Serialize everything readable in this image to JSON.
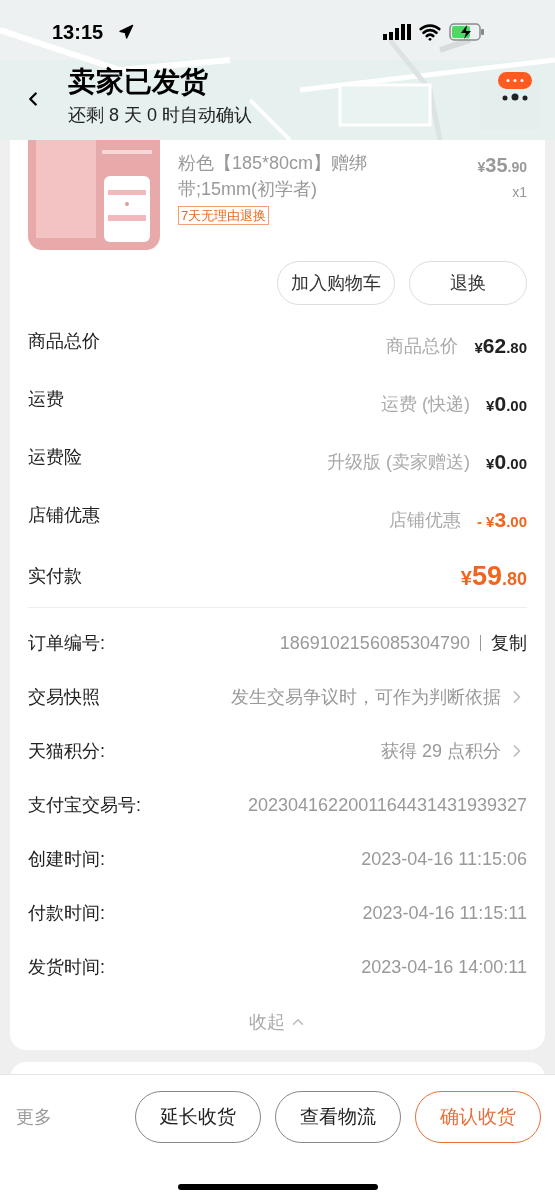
{
  "status_bar": {
    "time": "13:15"
  },
  "header": {
    "title": "卖家已发货",
    "subtitle": "还剩 8 天 0 时自动确认"
  },
  "product": {
    "spec": "粉色【185*80cm】赠绑带;15mm(初学者)",
    "tag": "7天无理由退换",
    "price": {
      "symbol": "¥",
      "integer": "35",
      "decimal": ".90"
    },
    "quantity": "x1",
    "buttons": [
      "加入购物车",
      "退换"
    ]
  },
  "fees": [
    {
      "label": "商品总价",
      "note": "商品总价",
      "amount": {
        "symbol": "¥",
        "integer": "62",
        "decimal": ".80"
      },
      "kind": "normal"
    },
    {
      "label": "运费",
      "note": "运费 (快递)",
      "amount": {
        "symbol": "¥",
        "integer": "0",
        "decimal": ".00"
      },
      "kind": "normal"
    },
    {
      "label": "运费险",
      "note": "升级版 (卖家赠送)",
      "amount": {
        "symbol": "¥",
        "integer": "0",
        "decimal": ".00"
      },
      "kind": "normal"
    },
    {
      "label": "店铺优惠",
      "note": "店铺优惠",
      "amount": {
        "sign": "-",
        "symbol": "¥",
        "integer": "3",
        "decimal": ".00"
      },
      "kind": "discount"
    }
  ],
  "total": {
    "label": "实付款",
    "amount": {
      "symbol": "¥",
      "integer": "59",
      "decimal": ".80"
    }
  },
  "info": [
    {
      "label": "订单编号:",
      "value": "1869102156085304790",
      "kind": "copy",
      "action": "复制"
    },
    {
      "label": "交易快照",
      "value": "发生交易争议时，可作为判断依据",
      "kind": "link"
    },
    {
      "label": "天猫积分:",
      "value": "获得 29 点积分",
      "kind": "link"
    },
    {
      "label": "支付宝交易号:",
      "value": "2023041622001164431431939327",
      "kind": "text"
    },
    {
      "label": "创建时间:",
      "value": "2023-04-16 11:15:06",
      "kind": "text"
    },
    {
      "label": "付款时间:",
      "value": "2023-04-16 11:15:11",
      "kind": "text"
    },
    {
      "label": "发货时间:",
      "value": "2023-04-16 14:00:11",
      "kind": "text"
    }
  ],
  "collapse": "收起",
  "bottom_bar": {
    "more": "更多",
    "buttons": [
      {
        "label": "延长收货",
        "primary": false
      },
      {
        "label": "查看物流",
        "primary": false
      },
      {
        "label": "确认收货",
        "primary": true
      }
    ]
  }
}
